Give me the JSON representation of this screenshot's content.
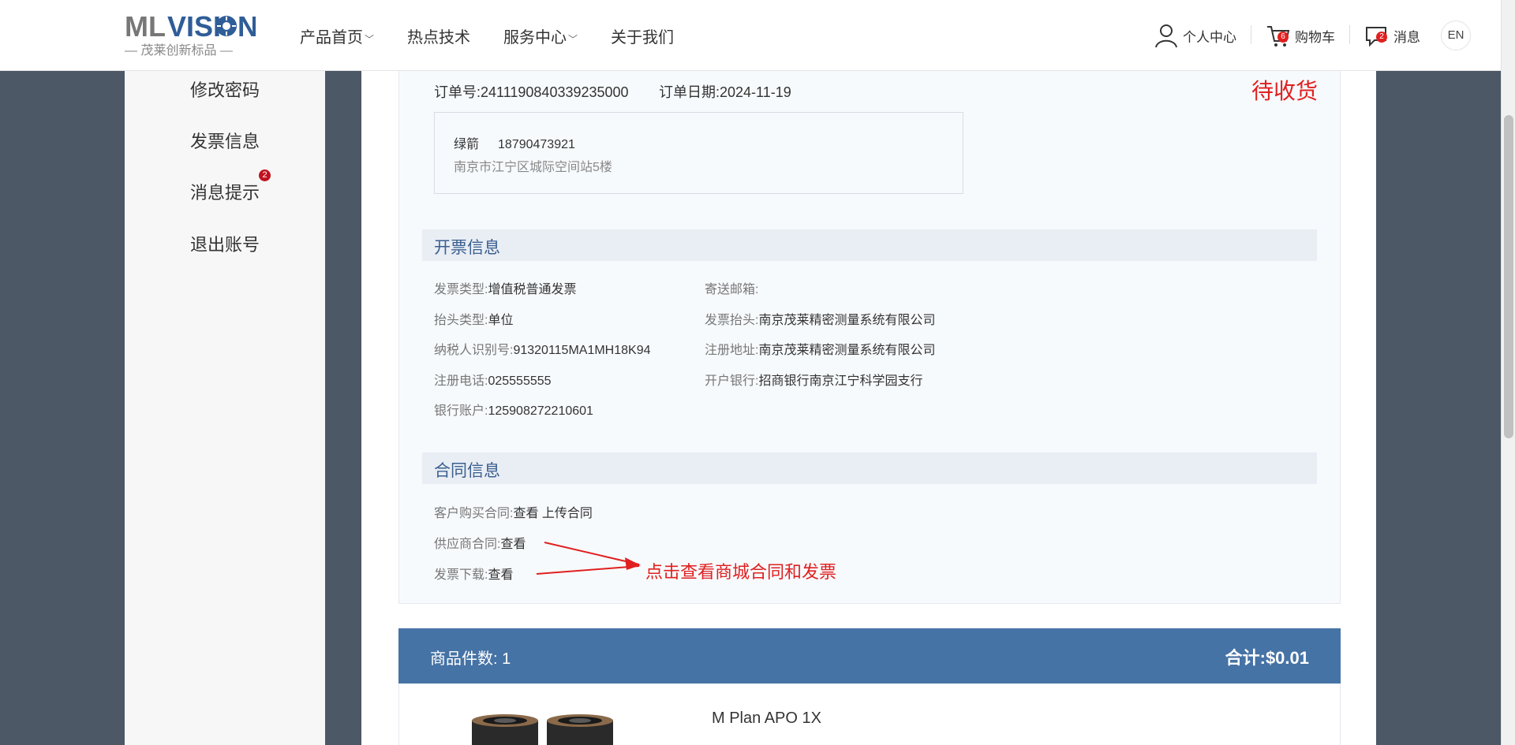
{
  "header": {
    "logo_main": "MLVISION",
    "logo_sub": "— 茂莱创新标品 —",
    "nav": [
      {
        "label": "产品首页",
        "has_dropdown": true
      },
      {
        "label": "热点技术",
        "has_dropdown": false
      },
      {
        "label": "服务中心",
        "has_dropdown": true
      },
      {
        "label": "关于我们",
        "has_dropdown": false
      }
    ],
    "user_center": "个人中心",
    "cart": "购物车",
    "cart_badge": "6",
    "messages": "消息",
    "messages_badge": "2",
    "lang": "EN"
  },
  "sidebar": {
    "items": [
      {
        "label": "修改密码"
      },
      {
        "label": "发票信息"
      },
      {
        "label": "消息提示",
        "badge": "2"
      },
      {
        "label": "退出账号"
      }
    ]
  },
  "order": {
    "number_label": "订单号:",
    "number": "2411190840339235000",
    "date_label": "订单日期:",
    "date": "2024-11-19",
    "status": "待收货",
    "recipient": "绿箭",
    "phone": "18790473921",
    "address": "南京市江宁区城际空间站5楼"
  },
  "invoice": {
    "title": "开票信息",
    "type_label": "发票类型:",
    "type": "增值税普通发票",
    "email_label": "寄送邮箱:",
    "email": "",
    "header_type_label": "抬头类型:",
    "header_type": "单位",
    "header_label": "发票抬头:",
    "header": "南京茂莱精密测量系统有限公司",
    "tax_id_label": "纳税人识别号:",
    "tax_id": "91320115MA1MH18K94",
    "reg_addr_label": "注册地址:",
    "reg_addr": "南京茂莱精密测量系统有限公司",
    "reg_phone_label": "注册电话:",
    "reg_phone": "025555555",
    "bank_label": "开户银行:",
    "bank": "招商银行南京江宁科学园支行",
    "account_label": "银行账户:",
    "account": "125908272210601"
  },
  "contract": {
    "title": "合同信息",
    "customer_label": "客户购买合同:",
    "customer_view": "查看",
    "customer_upload": "上传合同",
    "supplier_label": "供应商合同:",
    "supplier_view": "查看",
    "invoice_dl_label": "发票下载:",
    "invoice_dl_view": "查看",
    "annotation": "点击查看商城合同和发票"
  },
  "goods": {
    "count_label": "商品件数:",
    "count": "1",
    "total_label": "合计:",
    "total": "$0.01",
    "product_name": "M Plan APO 1X"
  },
  "colors": {
    "brand": "#2f5d97",
    "accent_red": "#e02020",
    "section_text": "#3b5f8f",
    "goods_bar": "#4673a5"
  }
}
